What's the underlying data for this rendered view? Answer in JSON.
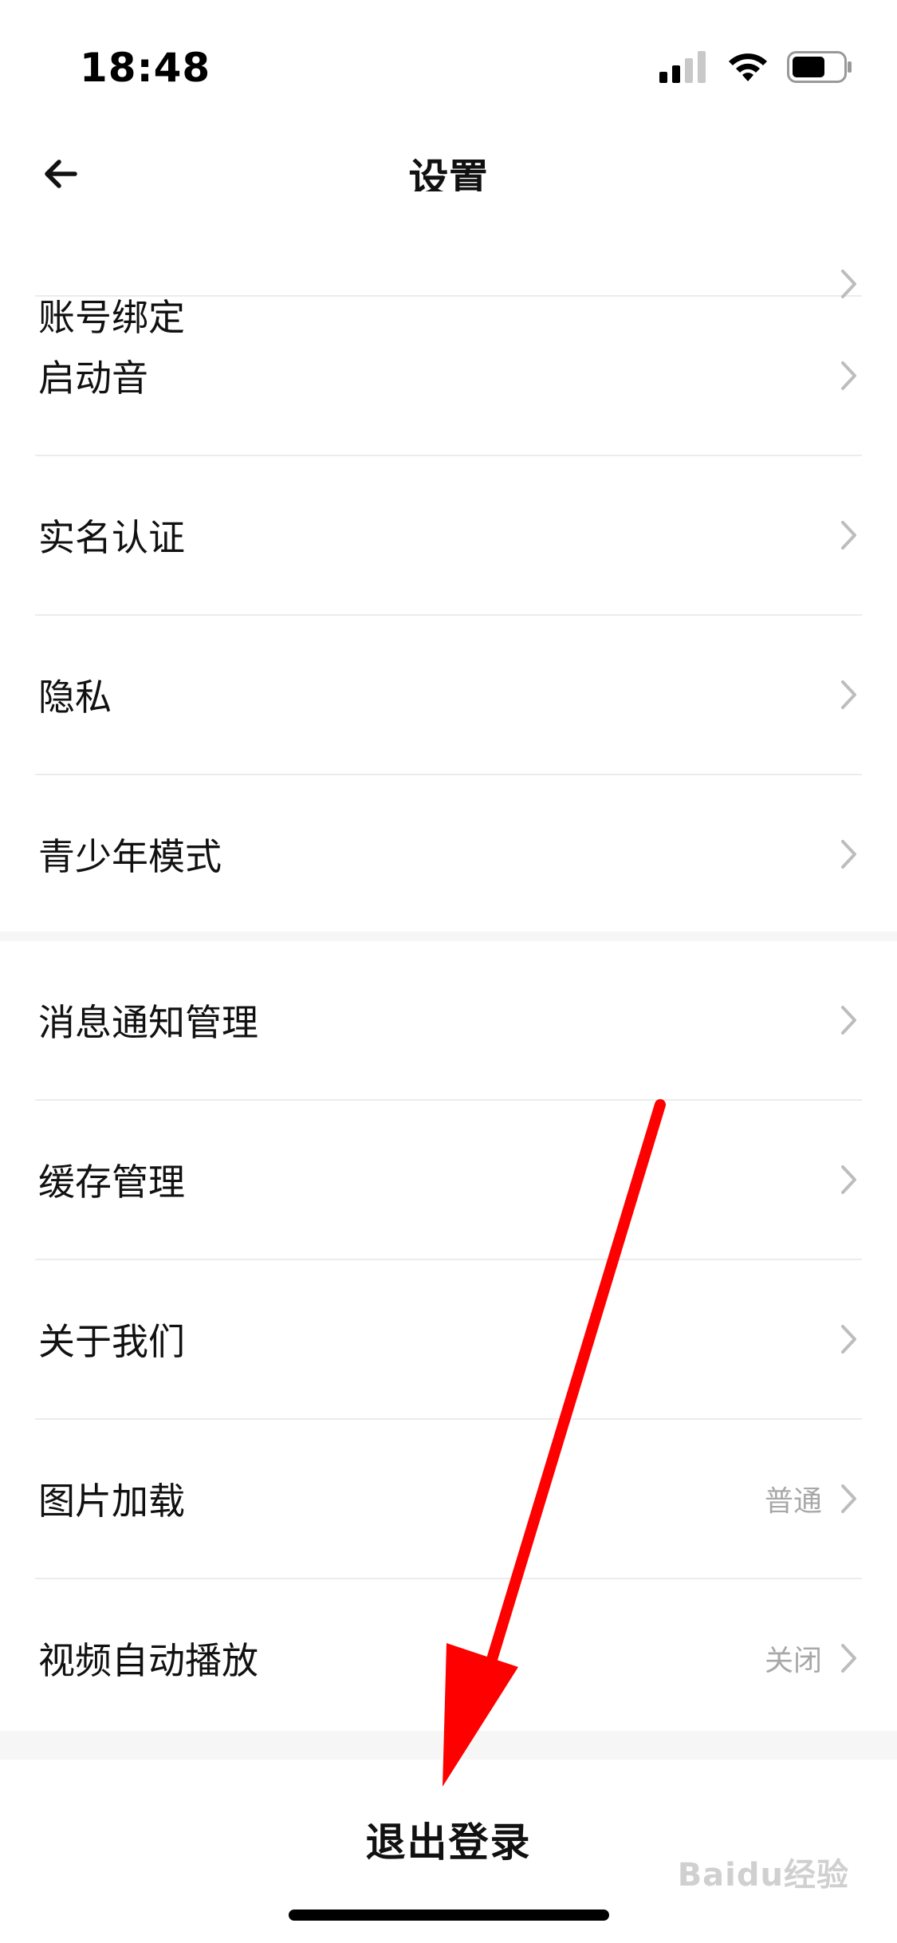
{
  "status_bar": {
    "time": "18:48",
    "icons": [
      "signal-icon",
      "wifi-icon",
      "battery-icon"
    ]
  },
  "nav": {
    "back_icon": "arrow-left-icon",
    "title": "设置"
  },
  "group1": {
    "items": [
      {
        "label": "账号绑定"
      },
      {
        "label": "启动音"
      },
      {
        "label": "实名认证"
      },
      {
        "label": "隐私"
      },
      {
        "label": "青少年模式"
      }
    ]
  },
  "group2": {
    "items": [
      {
        "label": "消息通知管理",
        "value": ""
      },
      {
        "label": "缓存管理",
        "value": ""
      },
      {
        "label": "关于我们",
        "value": ""
      },
      {
        "label": "图片加载",
        "value": "普通"
      },
      {
        "label": "视频自动播放",
        "value": "关闭"
      }
    ]
  },
  "logout": {
    "label": "退出登录"
  },
  "watermark": {
    "text": "Baidu经验"
  },
  "colors": {
    "annotation_arrow": "#ff0000",
    "value_text": "#a8a8a8",
    "divider": "#ececec"
  }
}
